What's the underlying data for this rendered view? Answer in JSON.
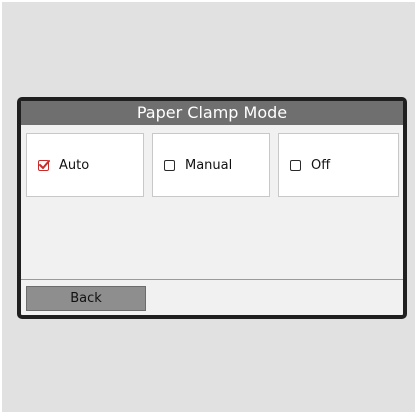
{
  "dialog": {
    "title": "Paper Clamp Mode"
  },
  "options": [
    {
      "label": "Auto",
      "checked": true,
      "icon": "checkbox-checked-icon"
    },
    {
      "label": "Manual",
      "checked": false,
      "icon": "checkbox-icon"
    },
    {
      "label": "Off",
      "checked": false,
      "icon": "checkbox-icon"
    }
  ],
  "footer": {
    "back_label": "Back"
  },
  "colors": {
    "title_bar": "#6f6f6f",
    "checked_accent": "#c92a2a",
    "panel_border": "#1f1f1f",
    "button_bg": "#8e8e8e"
  }
}
